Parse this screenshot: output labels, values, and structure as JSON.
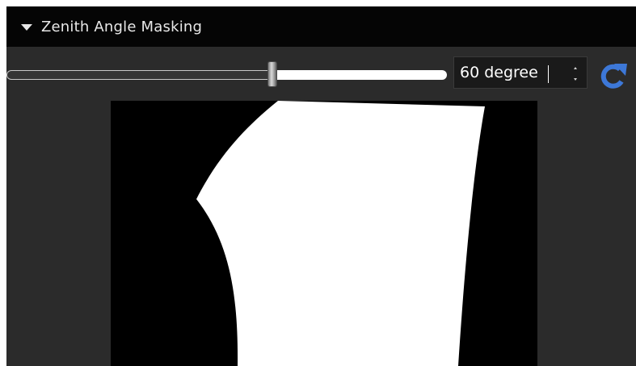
{
  "section": {
    "title": "Zenith Angle Masking",
    "expanded": true
  },
  "slider": {
    "value_fraction": 0.6
  },
  "spinbox": {
    "value": "60 degree"
  },
  "icons": {
    "collapse": "triangle-down-icon",
    "reset": "refresh-icon",
    "reset_color": "#3d78d8"
  },
  "preview": {
    "background": "#000000",
    "mask_color": "#ffffff"
  }
}
